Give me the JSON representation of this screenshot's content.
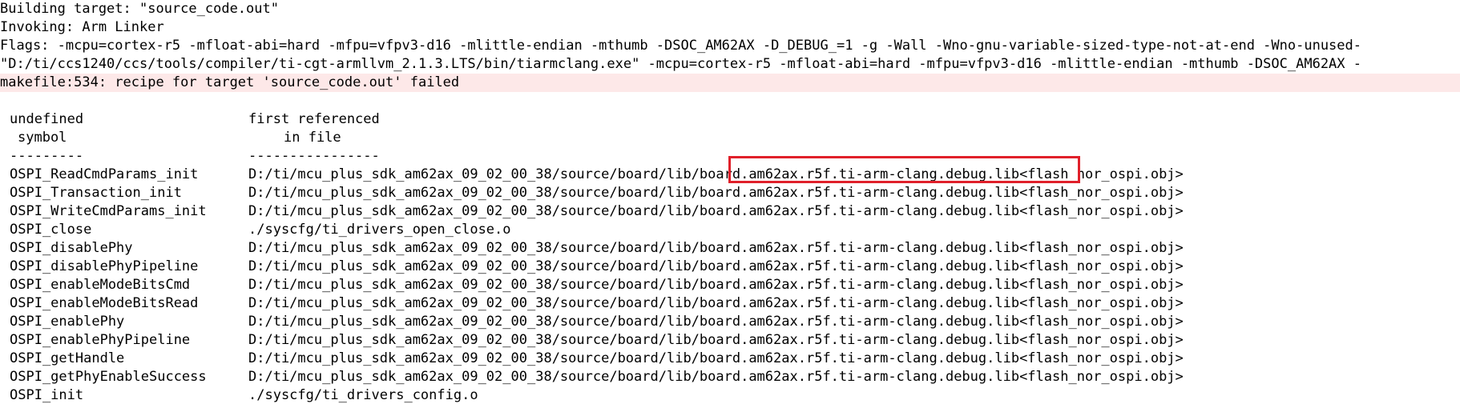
{
  "console": {
    "lines": [
      "Building target: \"source_code.out\"",
      "Invoking: Arm Linker",
      "Flags: -mcpu=cortex-r5 -mfloat-abi=hard -mfpu=vfpv3-d16 -mlittle-endian -mthumb -DSOC_AM62AX -D_DEBUG_=1 -g -Wall -Wno-gnu-variable-sized-type-not-at-end -Wno-unused-",
      "\"D:/ti/ccs1240/ccs/tools/compiler/ti-cgt-armllvm_2.1.3.LTS/bin/tiarmclang.exe\" -mcpu=cortex-r5 -mfloat-abi=hard -mfpu=vfpv3-d16 -mlittle-endian -mthumb -DSOC_AM62AX -",
      "makefile:534: recipe for target 'source_code.out' failed"
    ],
    "error_line_color": "#fde8e8"
  },
  "table": {
    "headers": {
      "symbol_line1": "undefined",
      "symbol_line2": "symbol",
      "file_line1": "first referenced",
      "file_line2": "in file",
      "symbol_sep": "---------",
      "file_sep": "----------------"
    },
    "rows": [
      {
        "symbol": "OSPI_ReadCmdParams_init",
        "file": "D:/ti/mcu_plus_sdk_am62ax_09_02_00_38/source/board/lib/board.am62ax.r5f.ti-arm-clang.debug.lib<flash_nor_ospi.obj>"
      },
      {
        "symbol": "OSPI_Transaction_init",
        "file": "D:/ti/mcu_plus_sdk_am62ax_09_02_00_38/source/board/lib/board.am62ax.r5f.ti-arm-clang.debug.lib<flash_nor_ospi.obj>"
      },
      {
        "symbol": "OSPI_WriteCmdParams_init",
        "file": "D:/ti/mcu_plus_sdk_am62ax_09_02_00_38/source/board/lib/board.am62ax.r5f.ti-arm-clang.debug.lib<flash_nor_ospi.obj>"
      },
      {
        "symbol": "OSPI_close",
        "file": "./syscfg/ti_drivers_open_close.o"
      },
      {
        "symbol": "OSPI_disablePhy",
        "file": "D:/ti/mcu_plus_sdk_am62ax_09_02_00_38/source/board/lib/board.am62ax.r5f.ti-arm-clang.debug.lib<flash_nor_ospi.obj>"
      },
      {
        "symbol": "OSPI_disablePhyPipeline",
        "file": "D:/ti/mcu_plus_sdk_am62ax_09_02_00_38/source/board/lib/board.am62ax.r5f.ti-arm-clang.debug.lib<flash_nor_ospi.obj>"
      },
      {
        "symbol": "OSPI_enableModeBitsCmd",
        "file": "D:/ti/mcu_plus_sdk_am62ax_09_02_00_38/source/board/lib/board.am62ax.r5f.ti-arm-clang.debug.lib<flash_nor_ospi.obj>"
      },
      {
        "symbol": "OSPI_enableModeBitsRead",
        "file": "D:/ti/mcu_plus_sdk_am62ax_09_02_00_38/source/board/lib/board.am62ax.r5f.ti-arm-clang.debug.lib<flash_nor_ospi.obj>"
      },
      {
        "symbol": "OSPI_enablePhy",
        "file": "D:/ti/mcu_plus_sdk_am62ax_09_02_00_38/source/board/lib/board.am62ax.r5f.ti-arm-clang.debug.lib<flash_nor_ospi.obj>"
      },
      {
        "symbol": "OSPI_enablePhyPipeline",
        "file": "D:/ti/mcu_plus_sdk_am62ax_09_02_00_38/source/board/lib/board.am62ax.r5f.ti-arm-clang.debug.lib<flash_nor_ospi.obj>"
      },
      {
        "symbol": "OSPI_getHandle",
        "file": "D:/ti/mcu_plus_sdk_am62ax_09_02_00_38/source/board/lib/board.am62ax.r5f.ti-arm-clang.debug.lib<flash_nor_ospi.obj>"
      },
      {
        "symbol": "OSPI_getPhyEnableSuccess",
        "file": "D:/ti/mcu_plus_sdk_am62ax_09_02_00_38/source/board/lib/board.am62ax.r5f.ti-arm-clang.debug.lib<flash_nor_ospi.obj>"
      },
      {
        "symbol": "OSPI_init",
        "file": "./syscfg/ti_drivers_config.o"
      }
    ]
  },
  "annotation": {
    "highlighted_text": "board.am62ax.r5f.ti-arm-clang.debug.lib",
    "color": "#e0202a"
  }
}
